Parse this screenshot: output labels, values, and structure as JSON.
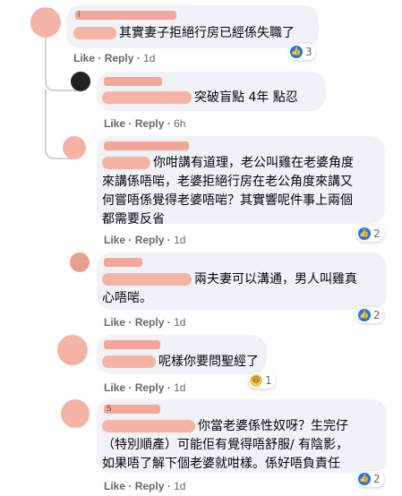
{
  "comments": [
    {
      "name": "l",
      "text": "其實妻子拒絕行房已經係失職了",
      "time": "1d",
      "reactions": "3",
      "reaction_type": "like"
    },
    {
      "name": "",
      "text": "突破盲點 4年 點忍",
      "time": "6h",
      "reactions": "",
      "reaction_type": ""
    },
    {
      "name": "",
      "text_lines": [
        "你咁講有道理，老公叫雞在老婆角度",
        "來講係唔啱，老婆拒絕行房在老公角度來講又",
        "何嘗唔係覺得老婆唔啱？其實響呢件事上兩個",
        "都需要反省"
      ],
      "time": "1d",
      "reactions": "2",
      "reaction_type": "like"
    },
    {
      "name": "",
      "text_lines": [
        "兩夫妻可以溝通，男人叫雞真",
        "心唔啱。"
      ],
      "time": "1d",
      "reactions": "2",
      "reaction_type": "like"
    },
    {
      "name": "",
      "text": "呢樣你要問聖經了",
      "time": "1d",
      "reactions": "1",
      "reaction_type": "haha"
    },
    {
      "name": "S",
      "text_lines": [
        "你當老婆係性奴呀？生完仔",
        "（特別順產）可能佢有覺得唔舒服/ 有陰影，",
        "如果唔了解下個老婆就咁樣。係好唔負責任"
      ],
      "time": "1d",
      "reactions": "2",
      "reaction_type": "like"
    }
  ],
  "labels": {
    "like": "Like",
    "reply": "Reply",
    "sep": "·"
  },
  "icons": {
    "like": "thumbs-up-icon",
    "haha": "laughing-face-icon"
  }
}
